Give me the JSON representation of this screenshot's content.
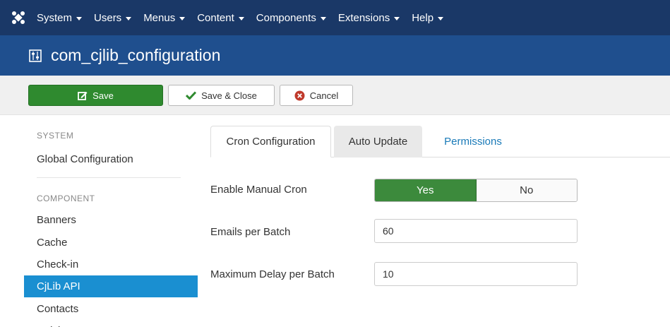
{
  "nav": {
    "logo_icon": "joomla-logo-icon",
    "items": [
      {
        "label": "System"
      },
      {
        "label": "Users"
      },
      {
        "label": "Menus"
      },
      {
        "label": "Content"
      },
      {
        "label": "Components"
      },
      {
        "label": "Extensions"
      },
      {
        "label": "Help"
      }
    ]
  },
  "header": {
    "icon": "equalizer-icon",
    "title": "com_cjlib_configuration"
  },
  "toolbar": {
    "save_label": "Save",
    "save_close_label": "Save & Close",
    "cancel_label": "Cancel"
  },
  "sidebar": {
    "system_heading": "SYSTEM",
    "global_configuration": "Global Configuration",
    "component_heading": "COMPONENT",
    "items": [
      {
        "label": "Banners"
      },
      {
        "label": "Cache"
      },
      {
        "label": "Check-in"
      },
      {
        "label": "CjLib API",
        "active": true
      },
      {
        "label": "Contacts"
      },
      {
        "label": "Articles"
      }
    ]
  },
  "tabs": [
    {
      "label": "Cron Configuration",
      "active": true
    },
    {
      "label": "Auto Update"
    },
    {
      "label": "Permissions"
    }
  ],
  "form": {
    "enable_manual_cron": {
      "label": "Enable Manual Cron",
      "yes": "Yes",
      "no": "No",
      "selected": "Yes"
    },
    "emails_per_batch": {
      "label": "Emails per Batch",
      "value": "60"
    },
    "maximum_delay": {
      "label": "Maximum Delay per Batch",
      "value": "10"
    }
  },
  "colors": {
    "nav_bg": "#1a3867",
    "title_bg": "#1f4f8e",
    "save_green": "#2f8a2f",
    "active_blue": "#1a8fd1",
    "link_blue": "#1a7ab8"
  }
}
